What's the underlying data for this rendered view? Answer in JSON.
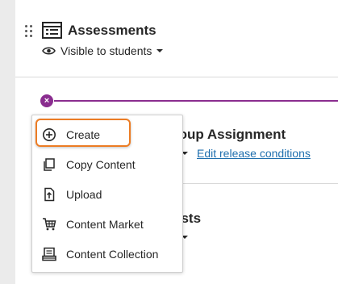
{
  "course": {
    "folder_title": "Assessments",
    "visibility": "Visible to students"
  },
  "content_items": [
    {
      "title_fragment": "roup Assignment",
      "release_link": "Edit release conditions"
    },
    {
      "title_fragment": "ests"
    }
  ],
  "add_menu": {
    "items": [
      {
        "label": "Create",
        "icon": "plus-circle-icon"
      },
      {
        "label": "Copy Content",
        "icon": "copy-icon"
      },
      {
        "label": "Upload",
        "icon": "upload-icon"
      },
      {
        "label": "Content Market",
        "icon": "cart-icon"
      },
      {
        "label": "Content Collection",
        "icon": "collection-icon"
      }
    ]
  },
  "colors": {
    "accent_purple": "#8a2d8f",
    "highlight_orange": "#ec7c24",
    "link_blue": "#1f6fae"
  }
}
